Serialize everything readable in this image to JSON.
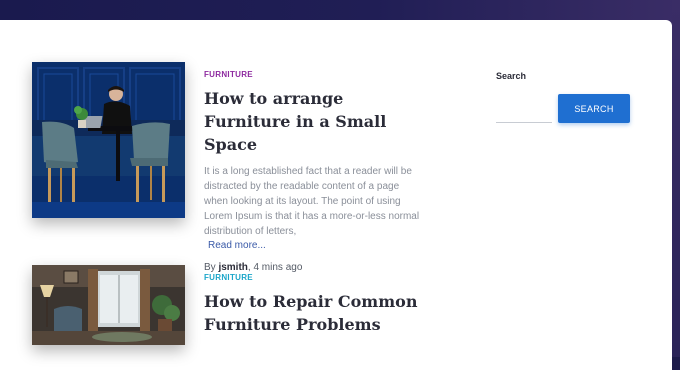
{
  "posts": [
    {
      "category": "FURNITURE",
      "title": "How to arrange Furniture in a Small Space",
      "excerpt": "It is a long established fact that a reader will be distracted by the readable content of a page when looking at its layout. The point of using Lorem Ipsum is that it has a more-or-less normal distribution of letters,",
      "read_more": "Read more...",
      "meta_by": "By ",
      "author": "jsmith",
      "time": ", 4 mins ago"
    },
    {
      "category": "FURNITURE",
      "title": "How to Repair Common Furniture Problems"
    }
  ],
  "sidebar": {
    "search_label": "Search",
    "search_placeholder": "",
    "search_button": "SEARCH"
  },
  "colors": {
    "category_purple": "#8e2aa0",
    "category_teal": "#1ba6c9",
    "accent_blue": "#1f6fd1",
    "header_navy": "#1a1a4e"
  }
}
